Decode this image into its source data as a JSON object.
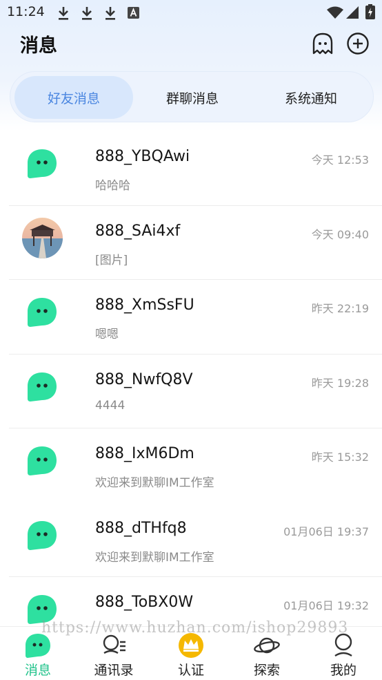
{
  "status_bar": {
    "time": "11:24",
    "left_icons": [
      "download-icon",
      "download-icon",
      "download-icon",
      "font-app-icon"
    ],
    "right_icons": [
      "wifi-icon",
      "cell-signal-icon",
      "battery-charging-icon"
    ]
  },
  "header": {
    "title": "消息",
    "buttons": [
      "ghost-icon",
      "add-circle-icon"
    ]
  },
  "tabs": [
    {
      "label": "好友消息",
      "active": true
    },
    {
      "label": "群聊消息",
      "active": false
    },
    {
      "label": "系统通知",
      "active": false
    }
  ],
  "messages": [
    {
      "name": "888_YBQAwi",
      "preview": "哈哈哈",
      "time": "今天 12:53",
      "avatar": "chat-bubble-avatar"
    },
    {
      "name": "888_SAi4xf",
      "preview": "[图片]",
      "time": "今天 09:40",
      "avatar": "photo-avatar"
    },
    {
      "name": "888_XmSsFU",
      "preview": "嗯嗯",
      "time": "昨天 22:19",
      "avatar": "chat-bubble-avatar"
    },
    {
      "name": "888_NwfQ8V",
      "preview": "4444",
      "time": "昨天 19:28",
      "avatar": "chat-bubble-avatar"
    },
    {
      "name": "888_IxM6Dm",
      "preview": "欢迎来到默聊IM工作室",
      "time": "昨天 15:32",
      "avatar": "chat-bubble-avatar"
    },
    {
      "name": "888_dTHfq8",
      "preview": "欢迎来到默聊IM工作室",
      "time": "01月06日 19:37",
      "avatar": "chat-bubble-avatar"
    },
    {
      "name": "888_ToBX0W",
      "preview": "",
      "time": "01月06日 19:32",
      "avatar": "chat-bubble-avatar"
    }
  ],
  "bottom_nav": [
    {
      "label": "消息",
      "icon": "chat-bubble-icon",
      "active": true
    },
    {
      "label": "通讯录",
      "icon": "contacts-icon",
      "active": false
    },
    {
      "label": "认证",
      "icon": "crown-icon",
      "active": false
    },
    {
      "label": "探索",
      "icon": "planet-icon",
      "active": false
    },
    {
      "label": "我的",
      "icon": "profile-icon",
      "active": false
    }
  ],
  "watermark": "https://www.huzhan.com/ishop29893",
  "colors": {
    "accent_green": "#2ee0a0",
    "tab_active_text": "#4a86e0",
    "nav_active": "#1fc28a",
    "crown_gold": "#f5b800"
  }
}
